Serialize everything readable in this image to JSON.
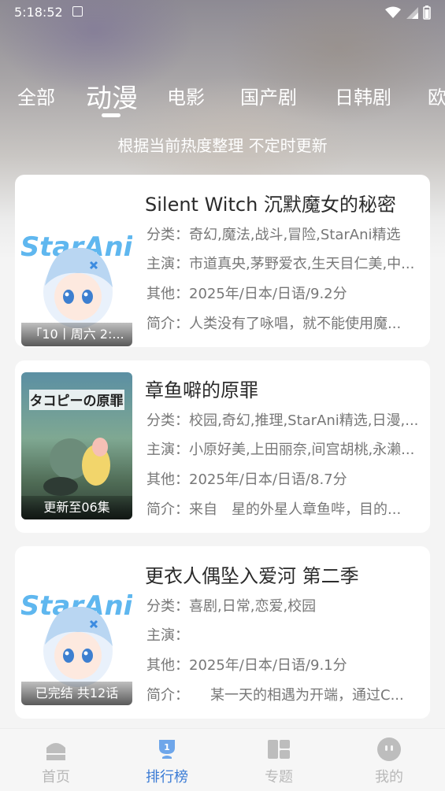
{
  "status_bar": {
    "time": "5:18:52"
  },
  "tabs": [
    {
      "label": "全部"
    },
    {
      "label": "动漫"
    },
    {
      "label": "电影"
    },
    {
      "label": "国产剧"
    },
    {
      "label": "日韩剧"
    },
    {
      "label": "欧"
    }
  ],
  "active_tab": "动漫",
  "subtitle": "根据当前热度整理 不定时更新",
  "cards": [
    {
      "title": "Silent Witch 沉默魔女的秘密",
      "poster_label": "「10丨周六 2:...",
      "poster_logo": "StarAni",
      "category_label": "分类：",
      "category": "奇幻,魔法,战斗,冒险,StarAni精选",
      "cast_label": "主演：",
      "cast": "市道真央,茅野爱衣,生天目仁美,中...",
      "other_label": "其他：",
      "other": "2025年/日本/日语/9.2分",
      "intro_label": "简介：",
      "intro": "人类没有了咏唱，就不能使用魔..."
    },
    {
      "title": "章鱼噼的原罪",
      "poster_label": "更新至06集",
      "poster_logo": "タコピーの原罪",
      "category_label": "分类：",
      "category": "校园,奇幻,推理,StarAni精选,日漫,...",
      "cast_label": "主演：",
      "cast": "小原好美,上田丽奈,间宫胡桃,永濑...",
      "other_label": "其他：",
      "other": "2025年/日本/日语/8.7分",
      "intro_label": "简介：",
      "intro": "来自　星的外星人章鱼哔，目的..."
    },
    {
      "title": "更衣人偶坠入爱河 第二季",
      "poster_label": "已完结 共12话",
      "poster_logo": "StarAni",
      "category_label": "分类：",
      "category": "喜剧,日常,恋爱,校园",
      "cast_label": "主演：",
      "cast": "",
      "other_label": "其他：",
      "other": "2025年/日本/日语/9.1分",
      "intro_label": "简介：",
      "intro": "　　某一天的相遇为开端，通过C..."
    }
  ],
  "bottom_nav": [
    {
      "label": "首页",
      "icon": "home-icon"
    },
    {
      "label": "排行榜",
      "icon": "trophy-icon",
      "badge": "1"
    },
    {
      "label": "专题",
      "icon": "grid-icon"
    },
    {
      "label": "我的",
      "icon": "profile-icon"
    }
  ],
  "colors": {
    "accent": "#3a7bd5",
    "nav_inactive": "#b8b8b8",
    "card_bg": "#ffffff"
  }
}
